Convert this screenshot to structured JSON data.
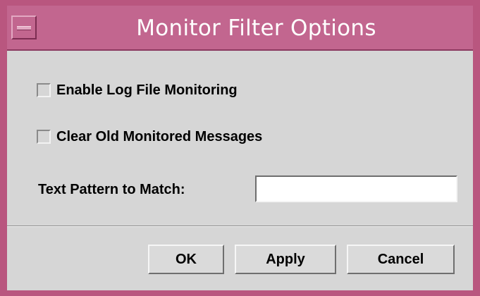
{
  "window": {
    "title": "Monitor Filter Options",
    "frame_color": "#b9567f",
    "titlebar_color": "#c2668f",
    "menu_icon": "window-menu-icon"
  },
  "options": {
    "enable_log_label": "Enable Log File Monitoring",
    "enable_log_checked": false,
    "clear_old_label": "Clear Old Monitored Messages",
    "clear_old_checked": false
  },
  "pattern": {
    "label": "Text Pattern to Match:",
    "value": ""
  },
  "buttons": {
    "ok": "OK",
    "apply": "Apply",
    "cancel": "Cancel"
  }
}
